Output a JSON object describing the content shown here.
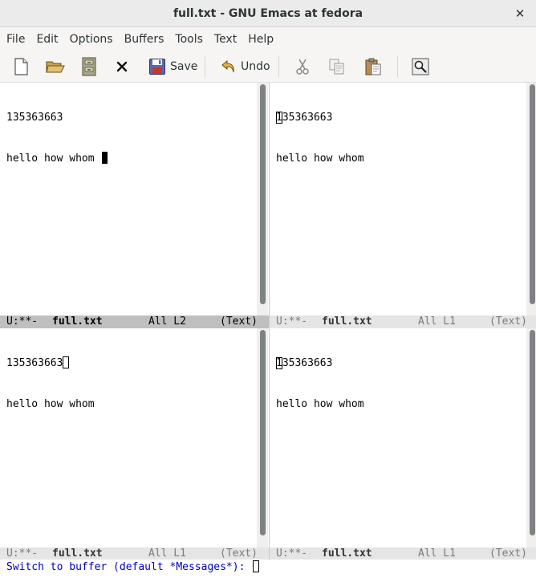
{
  "window": {
    "title": "full.txt - GNU Emacs at fedora",
    "close_glyph": "✕"
  },
  "menubar": {
    "items": [
      "File",
      "Edit",
      "Options",
      "Buffers",
      "Tools",
      "Text",
      "Help"
    ]
  },
  "toolbar": {
    "save_label": "Save",
    "undo_label": "Undo",
    "icons": [
      "new-file-icon",
      "open-folder-icon",
      "file-cabinet-icon",
      "close-buffer-icon",
      "save-icon",
      "undo-icon",
      "cut-icon",
      "copy-icon",
      "paste-icon",
      "search-icon"
    ]
  },
  "buffer": {
    "line1": "135363663",
    "line2": "hello how whom",
    "line1_rest": "35363663",
    "line1_first": "1"
  },
  "windows": {
    "top_left": {
      "status": "U:**-",
      "name": "full.txt",
      "position": "All L2",
      "mode": "(Text)",
      "active": true
    },
    "top_right": {
      "status": "U:**-",
      "name": "full.txt",
      "position": "All L1",
      "mode": "(Text)",
      "active": false
    },
    "bottom_left": {
      "status": "U:**-",
      "name": "full.txt",
      "position": "All L1",
      "mode": "(Text)",
      "active": false
    },
    "bottom_right": {
      "status": "U:**-",
      "name": "full.txt",
      "position": "All L1",
      "mode": "(Text)",
      "active": false
    }
  },
  "minibuffer": {
    "prompt": "Switch to buffer (default *Messages*): ",
    "value": ""
  },
  "colors": {
    "prompt": "#0000c0",
    "active_modeline": "#bfbfbf",
    "inactive_modeline": "#e5e5e5"
  }
}
